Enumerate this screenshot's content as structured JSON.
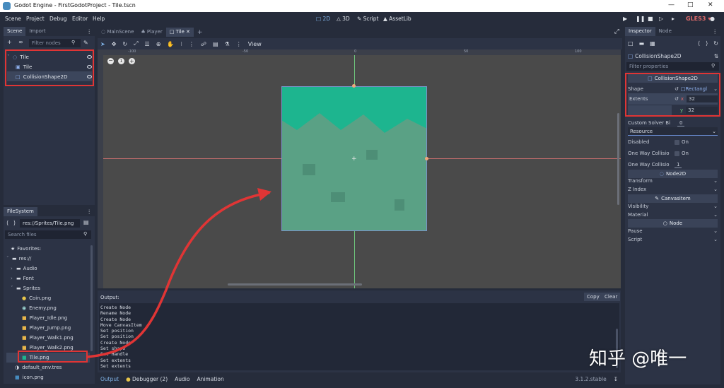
{
  "window": {
    "title": "Godot Engine - FirstGodotProject - Tile.tscn"
  },
  "menu": [
    "Scene",
    "Project",
    "Debug",
    "Editor",
    "Help"
  ],
  "workspaces": [
    {
      "label": "2D",
      "icon": "2d-icon",
      "active": true
    },
    {
      "label": "3D",
      "icon": "3d-icon",
      "active": false
    },
    {
      "label": "Script",
      "icon": "script-icon",
      "active": false
    },
    {
      "label": "AssetLib",
      "icon": "assetlib-icon",
      "active": false
    }
  ],
  "renderer": "GLES3",
  "scene_dock": {
    "tabs": [
      "Scene",
      "Import"
    ],
    "filter_placeholder": "Filter nodes",
    "tree": [
      {
        "label": "Tile",
        "icon": "node2d-icon",
        "depth": 0
      },
      {
        "label": "Tile",
        "icon": "sprite-icon",
        "depth": 1
      },
      {
        "label": "CollisionShape2D",
        "icon": "collision-shape-icon",
        "depth": 1
      }
    ]
  },
  "filesystem": {
    "tab": "FileSystem",
    "path": "res://Sprites/Tile.png",
    "search_placeholder": "Search files",
    "favorites": "Favorites:",
    "items": [
      {
        "label": "res://",
        "depth": 0,
        "type": "folder"
      },
      {
        "label": "Audio",
        "depth": 1,
        "type": "folder"
      },
      {
        "label": "Font",
        "depth": 1,
        "type": "folder"
      },
      {
        "label": "Sprites",
        "depth": 1,
        "type": "folder"
      },
      {
        "label": "Coin.png",
        "depth": 2,
        "type": "image"
      },
      {
        "label": "Enemy.png",
        "depth": 2,
        "type": "image"
      },
      {
        "label": "Player_Idle.png",
        "depth": 2,
        "type": "image"
      },
      {
        "label": "Player_Jump.png",
        "depth": 2,
        "type": "image"
      },
      {
        "label": "Player_Walk1.png",
        "depth": 2,
        "type": "image"
      },
      {
        "label": "Player_Walk2.png",
        "depth": 2,
        "type": "image"
      },
      {
        "label": "Tile.png",
        "depth": 2,
        "type": "image",
        "selected": true
      },
      {
        "label": "default_env.tres",
        "depth": 1,
        "type": "resource"
      },
      {
        "label": "icon.png",
        "depth": 1,
        "type": "image"
      }
    ]
  },
  "scene_tabs": [
    "MainScene",
    "Player",
    "Tile"
  ],
  "toolbar": {
    "view": "View"
  },
  "ruler": [
    "-100",
    "-50",
    "0",
    "50",
    "100"
  ],
  "output": {
    "title": "Output:",
    "copy": "Copy",
    "clear": "Clear",
    "lines": [
      "Create Node",
      "Rename Node",
      "Create Node",
      "Move CanvasItem",
      "Set position",
      "Set position",
      "Create Node",
      "Set shape",
      "Set Handle",
      "Set extents",
      "Set extents"
    ]
  },
  "bottom_tabs": [
    "Output",
    "Debugger (2)",
    "Audio",
    "Animation"
  ],
  "version": "3.1.2.stable",
  "inspector": {
    "tabs": [
      "Inspector",
      "Node"
    ],
    "object": "CollisionShape2D",
    "filter_placeholder": "Filter properties",
    "shape_header": "CollisionShape2D",
    "shape_label": "Shape",
    "shape_value": "Rectangl",
    "extents_label": "Extents",
    "extents_x": "32",
    "extents_y": "32",
    "custom_solver_label": "Custom Solver Bi",
    "custom_solver_value": "0",
    "resource": "Resource",
    "disabled_label": "Disabled",
    "disabled_value": "On",
    "oneway_label": "One Way Collisio",
    "oneway_value": "On",
    "oneway_margin_label": "One Way Collisio",
    "oneway_margin_value": "1",
    "node2d_header": "Node2D",
    "transform": "Transform",
    "zindex": "Z Index",
    "canvasitem_header": "CanvasItem",
    "visibility": "Visibility",
    "material": "Material",
    "node_header": "Node",
    "pause": "Pause",
    "script": "Script"
  },
  "watermark": "知乎 @唯一",
  "colors": {
    "accent": "#e03535",
    "tile_top": "#1db58f",
    "tile_body": "#5aa185",
    "viewport": "#4a4a4a"
  }
}
